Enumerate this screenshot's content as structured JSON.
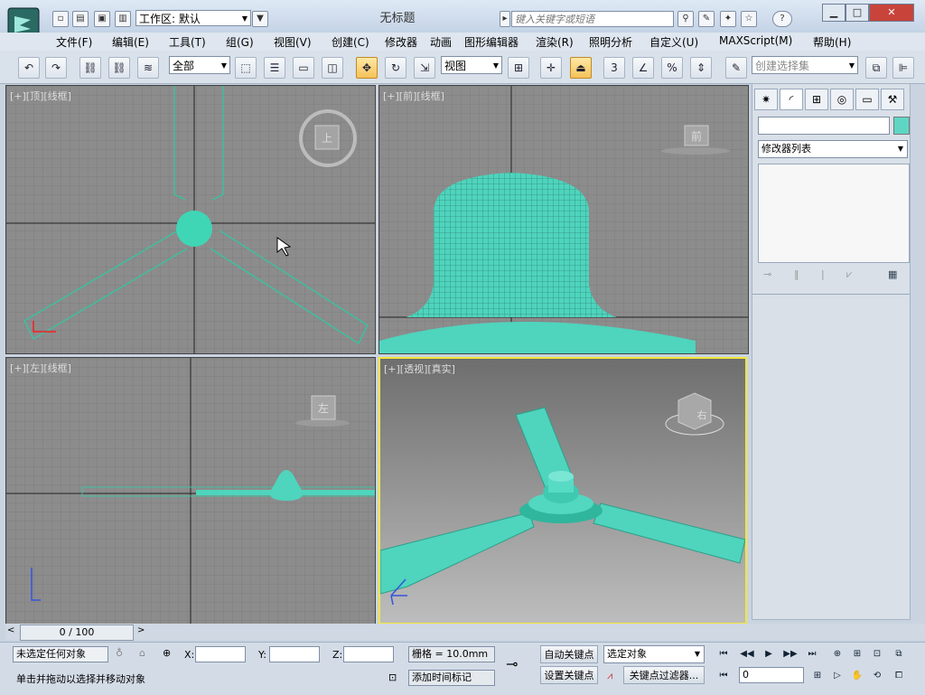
{
  "title_bar": {
    "workspace_label": "工作区: 默认",
    "title": "无标题",
    "search_placeholder": "键入关键字或短语",
    "help_label": "?"
  },
  "menu": [
    "文件(F)",
    "编辑(E)",
    "工具(T)",
    "组(G)",
    "视图(V)",
    "创建(C)",
    "修改器",
    "动画",
    "图形编辑器",
    "渲染(R)",
    "照明分析",
    "自定义(U)",
    "MAXScript(M)",
    "帮助(H)"
  ],
  "toolbar": {
    "selection_filter": "全部",
    "ref_coord": "视图",
    "named_selection_placeholder": "创建选择集",
    "snap_label": "3",
    "angle_snap_label": "%"
  },
  "viewports": {
    "top": {
      "label": "[+][顶][线框]",
      "cube_label": "上"
    },
    "front": {
      "label": "[+][前][线框]",
      "cube_label": "前"
    },
    "left": {
      "label": "[+][左][线框]",
      "cube_label": "左"
    },
    "perspective": {
      "label": "[+][透视][真实]",
      "cube_label": "右"
    }
  },
  "command_panel": {
    "modifier_list": "修改器列表",
    "name_field": "",
    "object_color": "#5fd6c4"
  },
  "timebar": {
    "frame": "0 / 100"
  },
  "status": {
    "selection": "未选定任何对象",
    "prompt": "单击并拖动以选择并移动对象",
    "x_label": "X:",
    "y_label": "Y:",
    "z_label": "Z:",
    "grid_label": "栅格 = 10.0mm",
    "auto_key": "自动关键点",
    "set_key": "设置关键点",
    "key_filter": "关键点过滤器...",
    "selected_objects": "选定对象",
    "add_time_tag": "添加时间标记",
    "current_frame": "0"
  },
  "colors": {
    "mesh": "#4fd4bd",
    "active_border": "#ffee33",
    "viewport_gray": "#8e8e8e"
  }
}
